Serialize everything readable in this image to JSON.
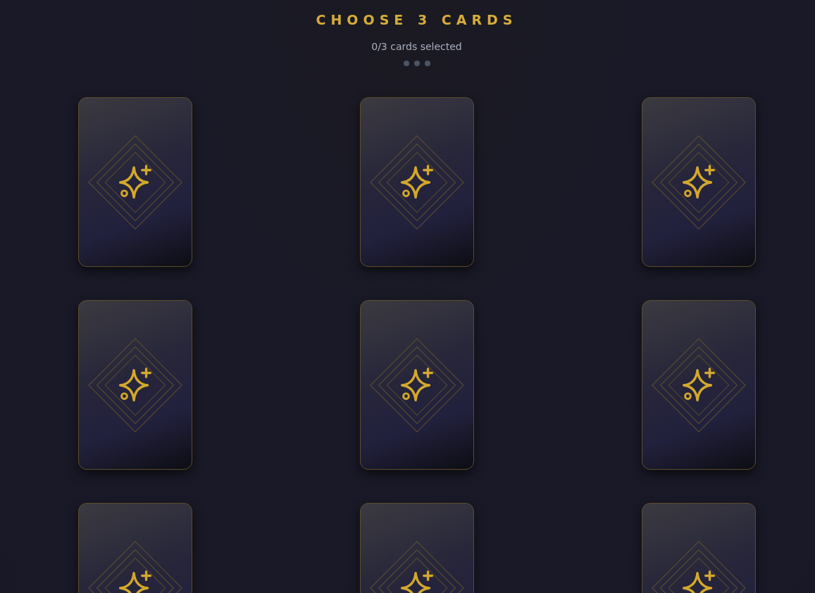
{
  "title": "CHOOSE 3 CARDS",
  "subtitle": "0/3 cards selected",
  "progress_dots": [
    {
      "on": false
    },
    {
      "on": false
    },
    {
      "on": false
    }
  ],
  "cards": [
    {
      "selected": false
    },
    {
      "selected": false
    },
    {
      "selected": false
    },
    {
      "selected": false
    },
    {
      "selected": false
    },
    {
      "selected": false
    },
    {
      "selected": false
    },
    {
      "selected": false
    },
    {
      "selected": false
    }
  ]
}
